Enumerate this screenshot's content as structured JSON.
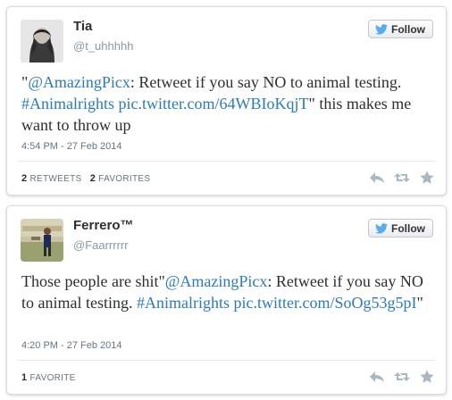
{
  "tweets": [
    {
      "name": "Tia",
      "handle": "@t_uhhhhh",
      "follow_label": "Follow",
      "text_segments": [
        {
          "t": "\"",
          "link": false
        },
        {
          "t": "@AmazingPicx",
          "link": true
        },
        {
          "t": ": Retweet if you say NO to animal testing. ",
          "link": false
        },
        {
          "t": "#Animalrights",
          "link": true
        },
        {
          "t": " ",
          "link": false
        },
        {
          "t": "pic.twitter.com/64WBIoKqjT",
          "link": true
        },
        {
          "t": "\" this makes me want to throw up",
          "link": false
        }
      ],
      "timestamp": "4:54 PM - 27 Feb 2014",
      "stats": [
        {
          "count": "2",
          "label": "RETWEETS"
        },
        {
          "count": "2",
          "label": "FAVORITES"
        }
      ]
    },
    {
      "name": "Ferrero™",
      "handle": "@Faarrrrrr",
      "follow_label": "Follow",
      "text_segments": [
        {
          "t": "Those people are shit\"",
          "link": false
        },
        {
          "t": "@AmazingPicx",
          "link": true
        },
        {
          "t": ": Retweet if you say NO to animal testing. ",
          "link": false
        },
        {
          "t": "#Animalrights",
          "link": true
        },
        {
          "t": " ",
          "link": false
        },
        {
          "t": "pic.twitter.com/SoOg53g5pI",
          "link": true
        },
        {
          "t": "\"",
          "link": false
        }
      ],
      "timestamp": "4:20 PM - 27 Feb 2014",
      "stats": [
        {
          "count": "1",
          "label": "FAVORITE"
        }
      ]
    }
  ],
  "icons": {
    "follow": "twitter-bird-icon",
    "reply": "reply-icon",
    "retweet": "retweet-icon",
    "favorite": "star-icon"
  },
  "colors": {
    "link": "#2b7bb9",
    "twitter_blue": "#55acee",
    "action_gray": "#aab8c2"
  }
}
